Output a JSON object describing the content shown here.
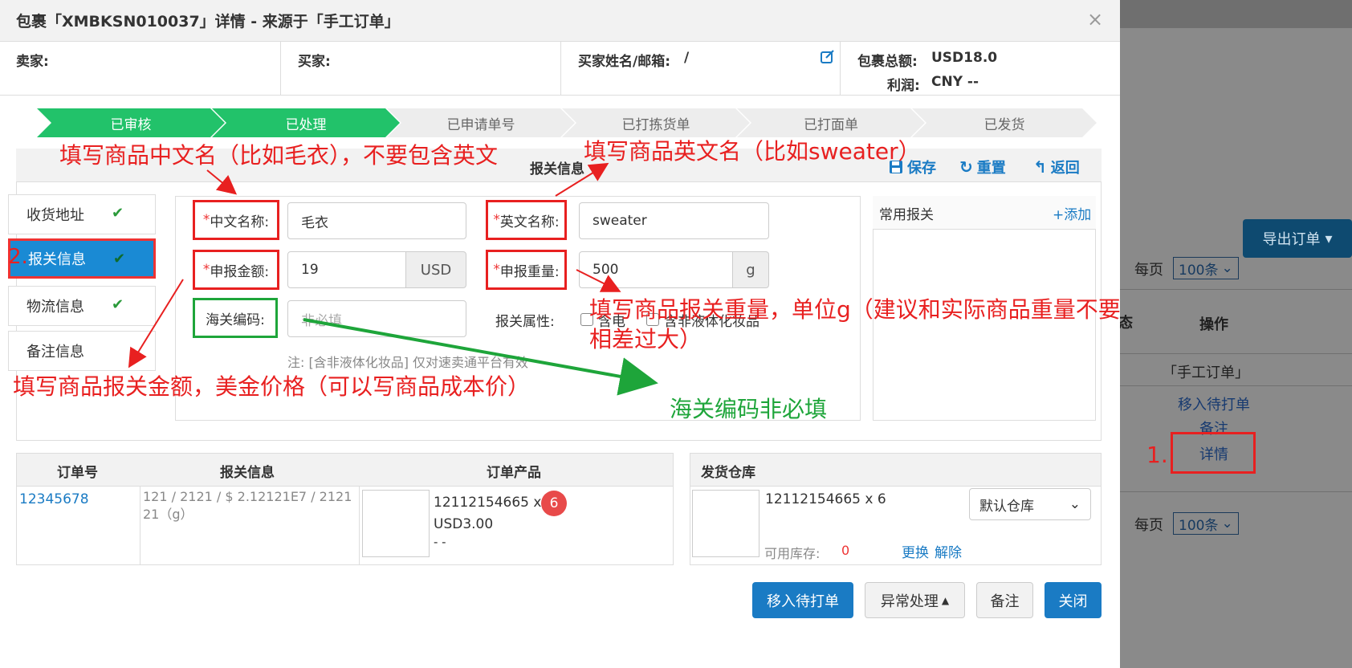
{
  "modal": {
    "title": "包裹「XMBKSN010037」详情 - 来源于「手工订单」",
    "close": "×"
  },
  "info": {
    "seller_label": "卖家:",
    "buyer_label": "买家:",
    "buyer_name_label": "买家姓名/邮箱:",
    "buyer_name_value": "/",
    "total_label": "包裹总额:",
    "total_value": "USD18.0",
    "profit_label": "利润:",
    "profit_value": "CNY --"
  },
  "steps": [
    "已审核",
    "已处理",
    "已申请单号",
    "已打拣货单",
    "已打面单",
    "已发货"
  ],
  "panel": {
    "title": "报关信息",
    "save": "保存",
    "reset": "重置",
    "back": "返回"
  },
  "tabs": [
    "收货地址",
    "报关信息",
    "物流信息",
    "备注信息"
  ],
  "form": {
    "cn_name_label": "中文名称:",
    "cn_name_value": "毛衣",
    "en_name_label": "英文名称:",
    "en_name_value": "sweater",
    "amount_label": "申报金额:",
    "amount_value": "19",
    "amount_unit": "USD",
    "weight_label": "申报重量:",
    "weight_value": "500",
    "weight_unit": "g",
    "hs_label": "海关编码:",
    "hs_placeholder": "非必填",
    "attr_label": "报关属性:",
    "attr_opt1": "含电",
    "attr_opt2": "含非液体化妆品",
    "note": "注: [含非液体化妆品] 仅对速卖通平台有效",
    "required_mark": "*"
  },
  "common": {
    "title": "常用报关",
    "add": "+添加"
  },
  "order_table": {
    "headers": [
      "订单号",
      "报关信息",
      "订单产品"
    ],
    "order_no": "12345678",
    "customs_info": "121 / 2121 / $ 2.12121E7 / 2121 21（g）",
    "product_sku": "12112154665 x",
    "product_qty": "6",
    "product_price": "USD3.00",
    "product_extra": "- -"
  },
  "warehouse": {
    "title": "发货仓库",
    "item": "12112154665 x 6",
    "stock_label": "可用库存:",
    "stock_value": "0",
    "swap": "更换",
    "release": "解除",
    "select_value": "默认仓库"
  },
  "footer": {
    "move": "移入待打单",
    "exception": "异常处理",
    "remark": "备注",
    "close": "关闭"
  },
  "background": {
    "export": "导出订单",
    "per_page": "每页",
    "per_page_value": "100条",
    "status_partial": "态",
    "op_header": "操作",
    "source": "「手工订单」",
    "move_link": "移入待打单",
    "remark_link": "备注",
    "detail_link": "详情",
    "per_page_2": "每页",
    "per_page_value_2": "100条"
  },
  "annotations": {
    "cn_name": "填写商品中文名（比如毛衣），不要包含英文",
    "en_name": "填写商品英文名（比如sweater）",
    "weight_1": "填写商品报关重量，单位g（建议和实际商品重量不要",
    "weight_2": "相差过大）",
    "amount": "填写商品报关金额，美金价格（可以写商品成本价）",
    "hs": "海关编码非必填",
    "step1": "1.",
    "step2": "2."
  },
  "colors": {
    "primary": "#1a7bc4",
    "step_done": "#22c26a",
    "annotation_red": "#e82020",
    "annotation_green": "#1ea53a"
  }
}
